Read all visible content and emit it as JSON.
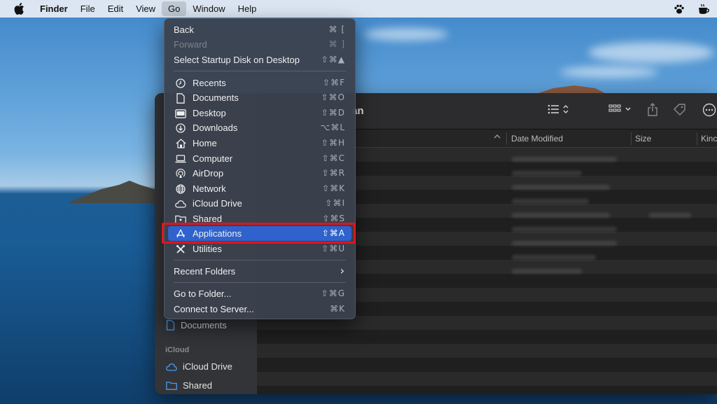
{
  "menubar": {
    "app_name": "Finder",
    "items": [
      "File",
      "Edit",
      "View",
      "Go",
      "Window",
      "Help"
    ]
  },
  "go_menu": {
    "back": {
      "label": "Back",
      "shortcut": "⌘ ["
    },
    "forward": {
      "label": "Forward",
      "shortcut": "⌘ ]"
    },
    "startup": {
      "label": "Select Startup Disk on Desktop",
      "shortcut": "⇧⌘▲"
    },
    "places": [
      {
        "label": "Recents",
        "shortcut": "⇧⌘F",
        "icon": "clock-icon"
      },
      {
        "label": "Documents",
        "shortcut": "⇧⌘O",
        "icon": "document-icon"
      },
      {
        "label": "Desktop",
        "shortcut": "⇧⌘D",
        "icon": "desktop-icon"
      },
      {
        "label": "Downloads",
        "shortcut": "⌥⌘L",
        "icon": "download-icon"
      },
      {
        "label": "Home",
        "shortcut": "⇧⌘H",
        "icon": "home-icon"
      },
      {
        "label": "Computer",
        "shortcut": "⇧⌘C",
        "icon": "laptop-icon"
      },
      {
        "label": "AirDrop",
        "shortcut": "⇧⌘R",
        "icon": "airdrop-icon"
      },
      {
        "label": "Network",
        "shortcut": "⇧⌘K",
        "icon": "globe-icon"
      },
      {
        "label": "iCloud Drive",
        "shortcut": "⇧⌘I",
        "icon": "cloud-icon"
      },
      {
        "label": "Shared",
        "shortcut": "⇧⌘S",
        "icon": "shared-folder-icon"
      },
      {
        "label": "Applications",
        "shortcut": "⇧⌘A",
        "icon": "applications-icon"
      },
      {
        "label": "Utilities",
        "shortcut": "⇧⌘U",
        "icon": "utilities-icon"
      }
    ],
    "recent_folders": {
      "label": "Recent Folders",
      "arrow": "›"
    },
    "go_to_folder": {
      "label": "Go to Folder...",
      "shortcut": "⇧⌘G"
    },
    "connect": {
      "label": "Connect to Server...",
      "shortcut": "⌘K"
    }
  },
  "finder": {
    "title_fragment": "an",
    "columns": {
      "date_modified": "Date Modified",
      "size": "Size",
      "kind": "Kinc"
    },
    "sidebar": {
      "documents": "Documents",
      "icloud_header": "iCloud",
      "icloud_drive": "iCloud Drive",
      "shared": "Shared"
    }
  },
  "colors": {
    "highlight": "#2f62cc",
    "annotation_box": "#e0141e",
    "menu_bg": "#3a424e"
  }
}
